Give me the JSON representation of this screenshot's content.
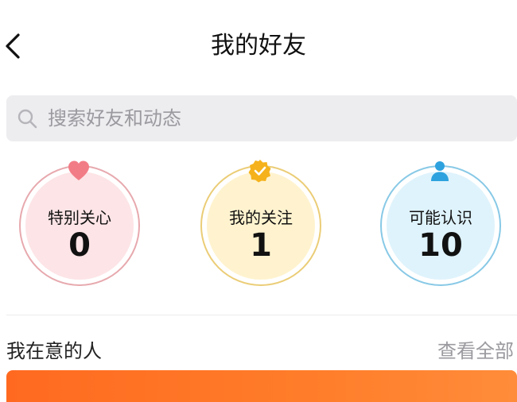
{
  "header": {
    "title": "我的好友",
    "back_icon": "chevron-left-icon"
  },
  "search": {
    "placeholder": "搜索好友和动态",
    "icon": "search-icon"
  },
  "stats": [
    {
      "label": "特别关心",
      "count": "0",
      "icon": "heart-icon",
      "accent": "#f27c86"
    },
    {
      "label": "我的关注",
      "count": "1",
      "icon": "verified-badge-icon",
      "accent": "#f5b21c"
    },
    {
      "label": "可能认识",
      "count": "10",
      "icon": "person-icon",
      "accent": "#2ea2de"
    }
  ],
  "section": {
    "title": "我在意的人",
    "view_all": "查看全部"
  },
  "colors": {
    "banner_start": "#ff6a20",
    "banner_end": "#ff8c3a",
    "search_bg": "#ededf0"
  }
}
